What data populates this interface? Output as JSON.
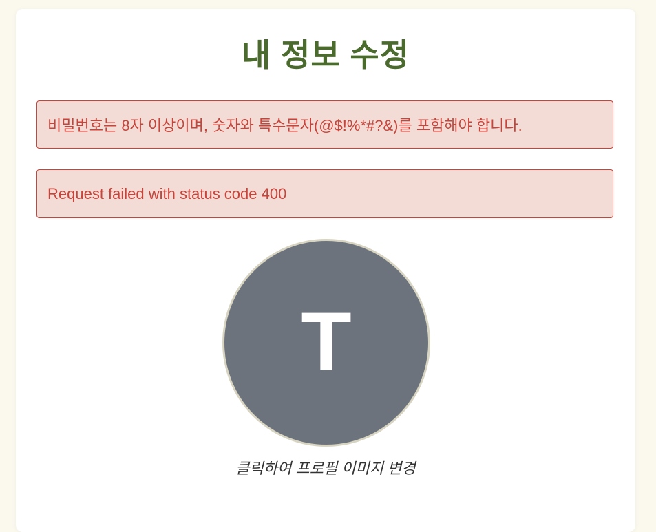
{
  "page": {
    "title": "내 정보 수정"
  },
  "alerts": [
    {
      "message": "비밀번호는 8자 이상이며, 숫자와 특수문자(@$!%*#?&)를 포함해야 합니다."
    },
    {
      "message": "Request failed with status code 400"
    }
  ],
  "profile": {
    "avatar_initial": "T",
    "change_hint": "클릭하여 프로필 이미지 변경"
  },
  "colors": {
    "background": "#fbf8ee",
    "title": "#4b6a2d",
    "alert_text": "#c8443a",
    "alert_bg": "#f3dcd6",
    "avatar_bg": "#6c737c"
  }
}
